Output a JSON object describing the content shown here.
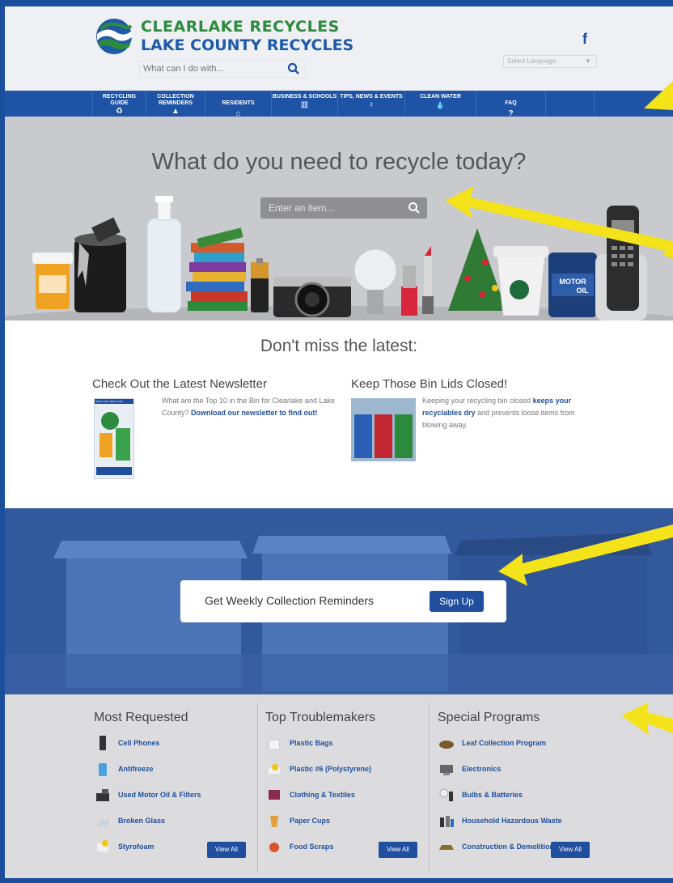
{
  "header": {
    "logo_line1": "CLEARLAKE RECYCLES",
    "logo_line2": "LAKE COUNTY RECYCLES",
    "search_placeholder": "What can I do with...",
    "language_select": "Select Language",
    "social_icon": "f"
  },
  "nav": [
    {
      "label": "RECYCLING GUIDE",
      "icon": "recycle-icon",
      "glyph": "♻"
    },
    {
      "label": "COLLECTION REMINDERS",
      "icon": "bell-icon",
      "glyph": "🔔"
    },
    {
      "label": "RESIDENTS",
      "icon": "home-icon",
      "glyph": "⌂"
    },
    {
      "label": "BUSINESS & SCHOOLS",
      "icon": "building-icon",
      "glyph": "▥"
    },
    {
      "label": "TIPS, NEWS & EVENTS",
      "icon": "lightbulb-icon",
      "glyph": "♀"
    },
    {
      "label": "CLEAN WATER",
      "icon": "water-drop-icon",
      "glyph": "●"
    },
    {
      "label": "FAQ",
      "icon": "question-icon",
      "glyph": "?"
    }
  ],
  "hero": {
    "title": "What do you need to recycle today?",
    "search_placeholder": "Enter an item...",
    "motor_oil_label_1": "MOTOR",
    "motor_oil_label_2": "OIL"
  },
  "news": {
    "title": "Don't miss the latest:",
    "story1": {
      "title": "Check Out the Latest Newsletter",
      "text": "What are the Top 10 in the Bin for Clearlake and Lake County?",
      "link": "Download our newsletter to find out!",
      "thumb_label": "WHAT CAN I RECYCLE?"
    },
    "story2": {
      "title": "Keep Those Bin Lids Closed!",
      "text_a": "Keeping your recycling bin closed",
      "link": "keeps your recyclables dry",
      "text_b": "and prevents loose items from blowing away."
    }
  },
  "promo": {
    "text": "Get Weekly Collection Reminders",
    "button": "Sign Up"
  },
  "most_requested": {
    "title": "Most Requested",
    "items": [
      "Cell Phones",
      "Antifreeze",
      "Used Motor Oil & Filters",
      "Broken Glass",
      "Styrofoam"
    ],
    "view_all": "View All"
  },
  "troublemakers": {
    "title": "Top Troublemakers",
    "items": [
      "Plastic Bags",
      "Plastic #6 (Polystyrene)",
      "Clothing & Textiles",
      "Paper Cups",
      "Food Scraps"
    ],
    "view_all": "View All"
  },
  "special": {
    "title": "Special Programs",
    "items": [
      "Leaf Collection Program",
      "Electronics",
      "Bulbs & Batteries",
      "Household Hazardous Waste",
      "Construction & Demolition"
    ],
    "view_all": "View All"
  },
  "colors": {
    "brand_blue": "#1e53a6",
    "brand_green": "#2e8b3e",
    "annotation_arrow": "#f4e21a"
  }
}
